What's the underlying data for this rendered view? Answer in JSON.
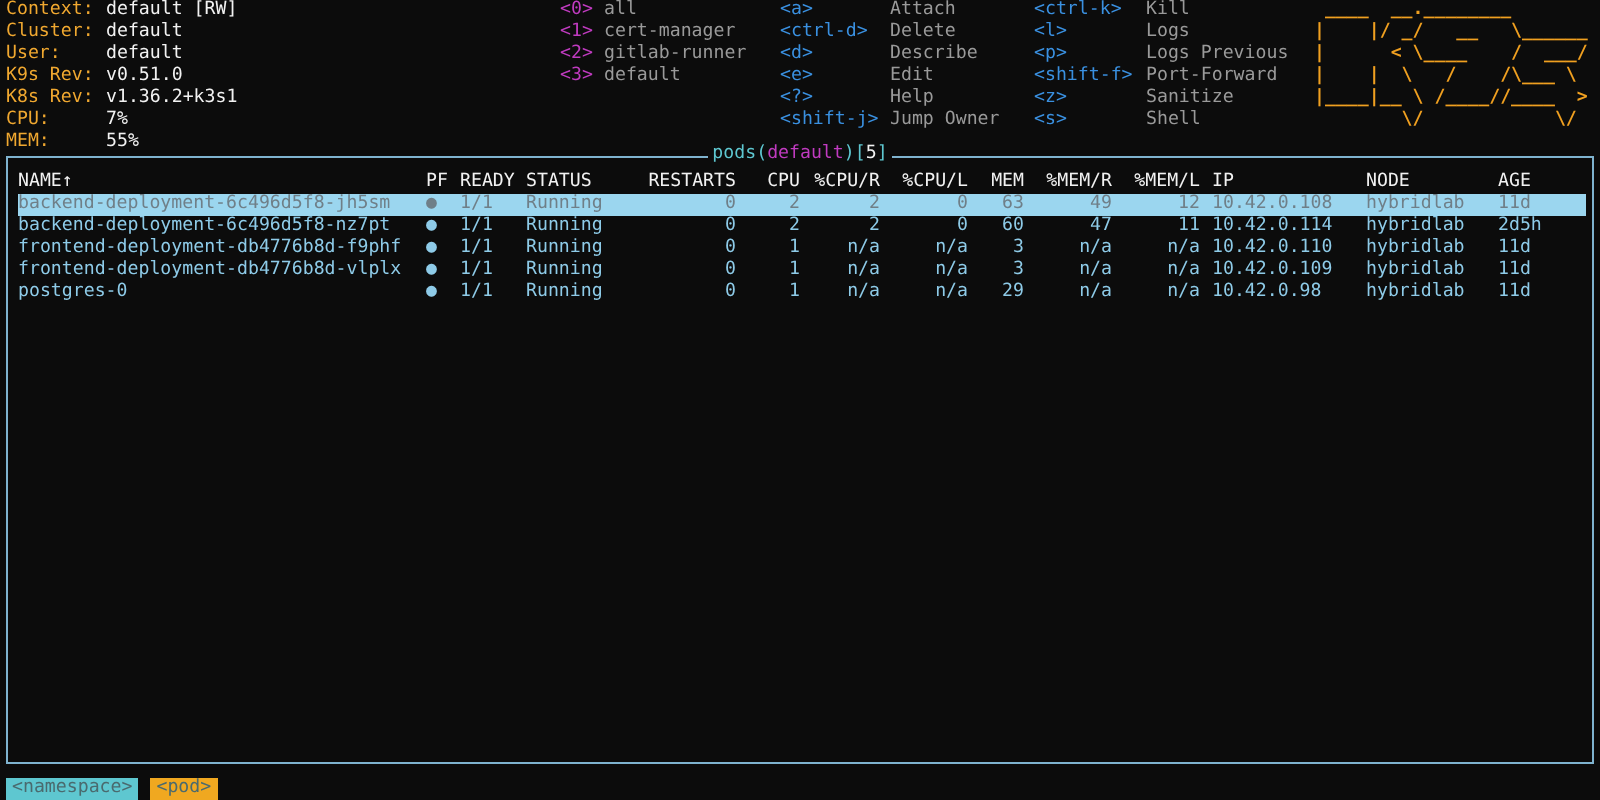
{
  "cluster_info": [
    {
      "label": "Context:",
      "value": "default [RW]"
    },
    {
      "label": "Cluster:",
      "value": "default"
    },
    {
      "label": "User:",
      "value": "default"
    },
    {
      "label": "K9s Rev:",
      "value": "v0.51.0"
    },
    {
      "label": "K8s Rev:",
      "value": "v1.36.2+k3s1"
    },
    {
      "label": "CPU:",
      "value": "7%"
    },
    {
      "label": "MEM:",
      "value": "55%"
    }
  ],
  "namespaces": [
    {
      "key": "<0>",
      "name": "all"
    },
    {
      "key": "<1>",
      "name": "cert-manager"
    },
    {
      "key": "<2>",
      "name": "gitlab-runner"
    },
    {
      "key": "<3>",
      "name": "default"
    }
  ],
  "shortcuts": [
    [
      {
        "key": "<a>",
        "action": "Attach"
      },
      {
        "key": "<ctrl-d>",
        "action": "Delete"
      },
      {
        "key": "<d>",
        "action": "Describe"
      },
      {
        "key": "<e>",
        "action": "Edit"
      },
      {
        "key": "<?>",
        "action": "Help"
      },
      {
        "key": "<shift-j>",
        "action": "Jump Owner"
      }
    ],
    [
      {
        "key": "<ctrl-k>",
        "action": "Kill"
      },
      {
        "key": "<l>",
        "action": "Logs"
      },
      {
        "key": "<p>",
        "action": "Logs Previous"
      },
      {
        "key": "<shift-f>",
        "action": "Port-Forward"
      },
      {
        "key": "<z>",
        "action": "Sanitize"
      },
      {
        "key": "<s>",
        "action": "Shell"
      }
    ]
  ],
  "logo": [
    " ____  __.________       ",
    "|    |/ _/   __   \\______",
    "|      < \\____    /  ___/",
    "|    |  \\   /    /\\___ \\ ",
    "|____|__ \\ /____//____  >",
    "        \\/            \\/ "
  ],
  "table": {
    "title": [
      {
        "text": "pods",
        "kind": "resource"
      },
      {
        "text": "(",
        "kind": "punct"
      },
      {
        "text": "default",
        "kind": "namespace"
      },
      {
        "text": ")[",
        "kind": "punct"
      },
      {
        "text": "5",
        "kind": "count"
      },
      {
        "text": "]",
        "kind": "punct"
      }
    ],
    "columns": [
      "NAME↑",
      "PF",
      "READY",
      "STATUS",
      "RESTARTS",
      "CPU",
      "%CPU/R",
      "%CPU/L",
      "MEM",
      "%MEM/R",
      "%MEM/L",
      "IP",
      "NODE",
      "AGE"
    ],
    "rows": [
      {
        "selected": true,
        "cells": [
          "backend-deployment-6c496d5f8-jh5sm",
          "●",
          "1/1",
          "Running",
          "0",
          "2",
          "2",
          "0",
          "63",
          "49",
          "12",
          "10.42.0.108",
          "hybridlab",
          "11d"
        ]
      },
      {
        "selected": false,
        "cells": [
          "backend-deployment-6c496d5f8-nz7pt",
          "●",
          "1/1",
          "Running",
          "0",
          "2",
          "2",
          "0",
          "60",
          "47",
          "11",
          "10.42.0.114",
          "hybridlab",
          "2d5h"
        ]
      },
      {
        "selected": false,
        "cells": [
          "frontend-deployment-db4776b8d-f9phf",
          "●",
          "1/1",
          "Running",
          "0",
          "1",
          "n/a",
          "n/a",
          "3",
          "n/a",
          "n/a",
          "10.42.0.110",
          "hybridlab",
          "11d"
        ]
      },
      {
        "selected": false,
        "cells": [
          "frontend-deployment-db4776b8d-vlplx",
          "●",
          "1/1",
          "Running",
          "0",
          "1",
          "n/a",
          "n/a",
          "3",
          "n/a",
          "n/a",
          "10.42.0.109",
          "hybridlab",
          "11d"
        ]
      },
      {
        "selected": false,
        "cells": [
          "postgres-0",
          "●",
          "1/1",
          "Running",
          "0",
          "1",
          "n/a",
          "n/a",
          "29",
          "n/a",
          "n/a",
          "10.42.0.98",
          "hybridlab",
          "11d"
        ]
      }
    ]
  },
  "breadcrumbs": [
    {
      "label": "<namespace>",
      "kind": "namespace"
    },
    {
      "label": "<pod>",
      "kind": "resource"
    }
  ]
}
